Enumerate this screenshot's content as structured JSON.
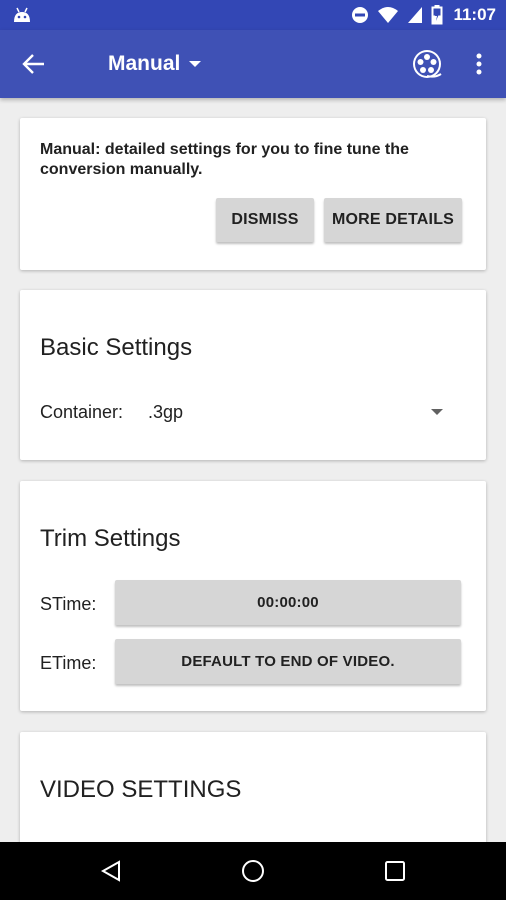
{
  "status_bar": {
    "time": "11:07",
    "icons": [
      "android-icon",
      "do-not-disturb-icon",
      "wifi-icon",
      "signal-icon",
      "battery-charging-icon"
    ]
  },
  "app_bar": {
    "title": "Manual",
    "icons": [
      "back-arrow-icon",
      "dropdown-caret-icon",
      "film-reel-icon",
      "overflow-menu-icon"
    ]
  },
  "info_card": {
    "text": "Manual: detailed settings for you to fine tune the conversion manually.",
    "dismiss_label": "DISMISS",
    "more_details_label": "MORE DETAILS"
  },
  "basic_settings": {
    "title": "Basic Settings",
    "container_label": "Container:",
    "container_value": ".3gp"
  },
  "trim_settings": {
    "title": "Trim Settings",
    "stime_label": "STime:",
    "stime_value": "00:00:00",
    "etime_label": "ETime:",
    "etime_value": "DEFAULT TO END OF VIDEO."
  },
  "video_settings": {
    "title": "VIDEO SETTINGS"
  },
  "nav_bar": {
    "icons": [
      "nav-back-icon",
      "nav-home-icon",
      "nav-recents-icon"
    ]
  },
  "colors": {
    "status_bar": "#3347b5",
    "app_bar": "#3f51b5",
    "background": "#eeeeee",
    "button": "#d6d6d6"
  }
}
